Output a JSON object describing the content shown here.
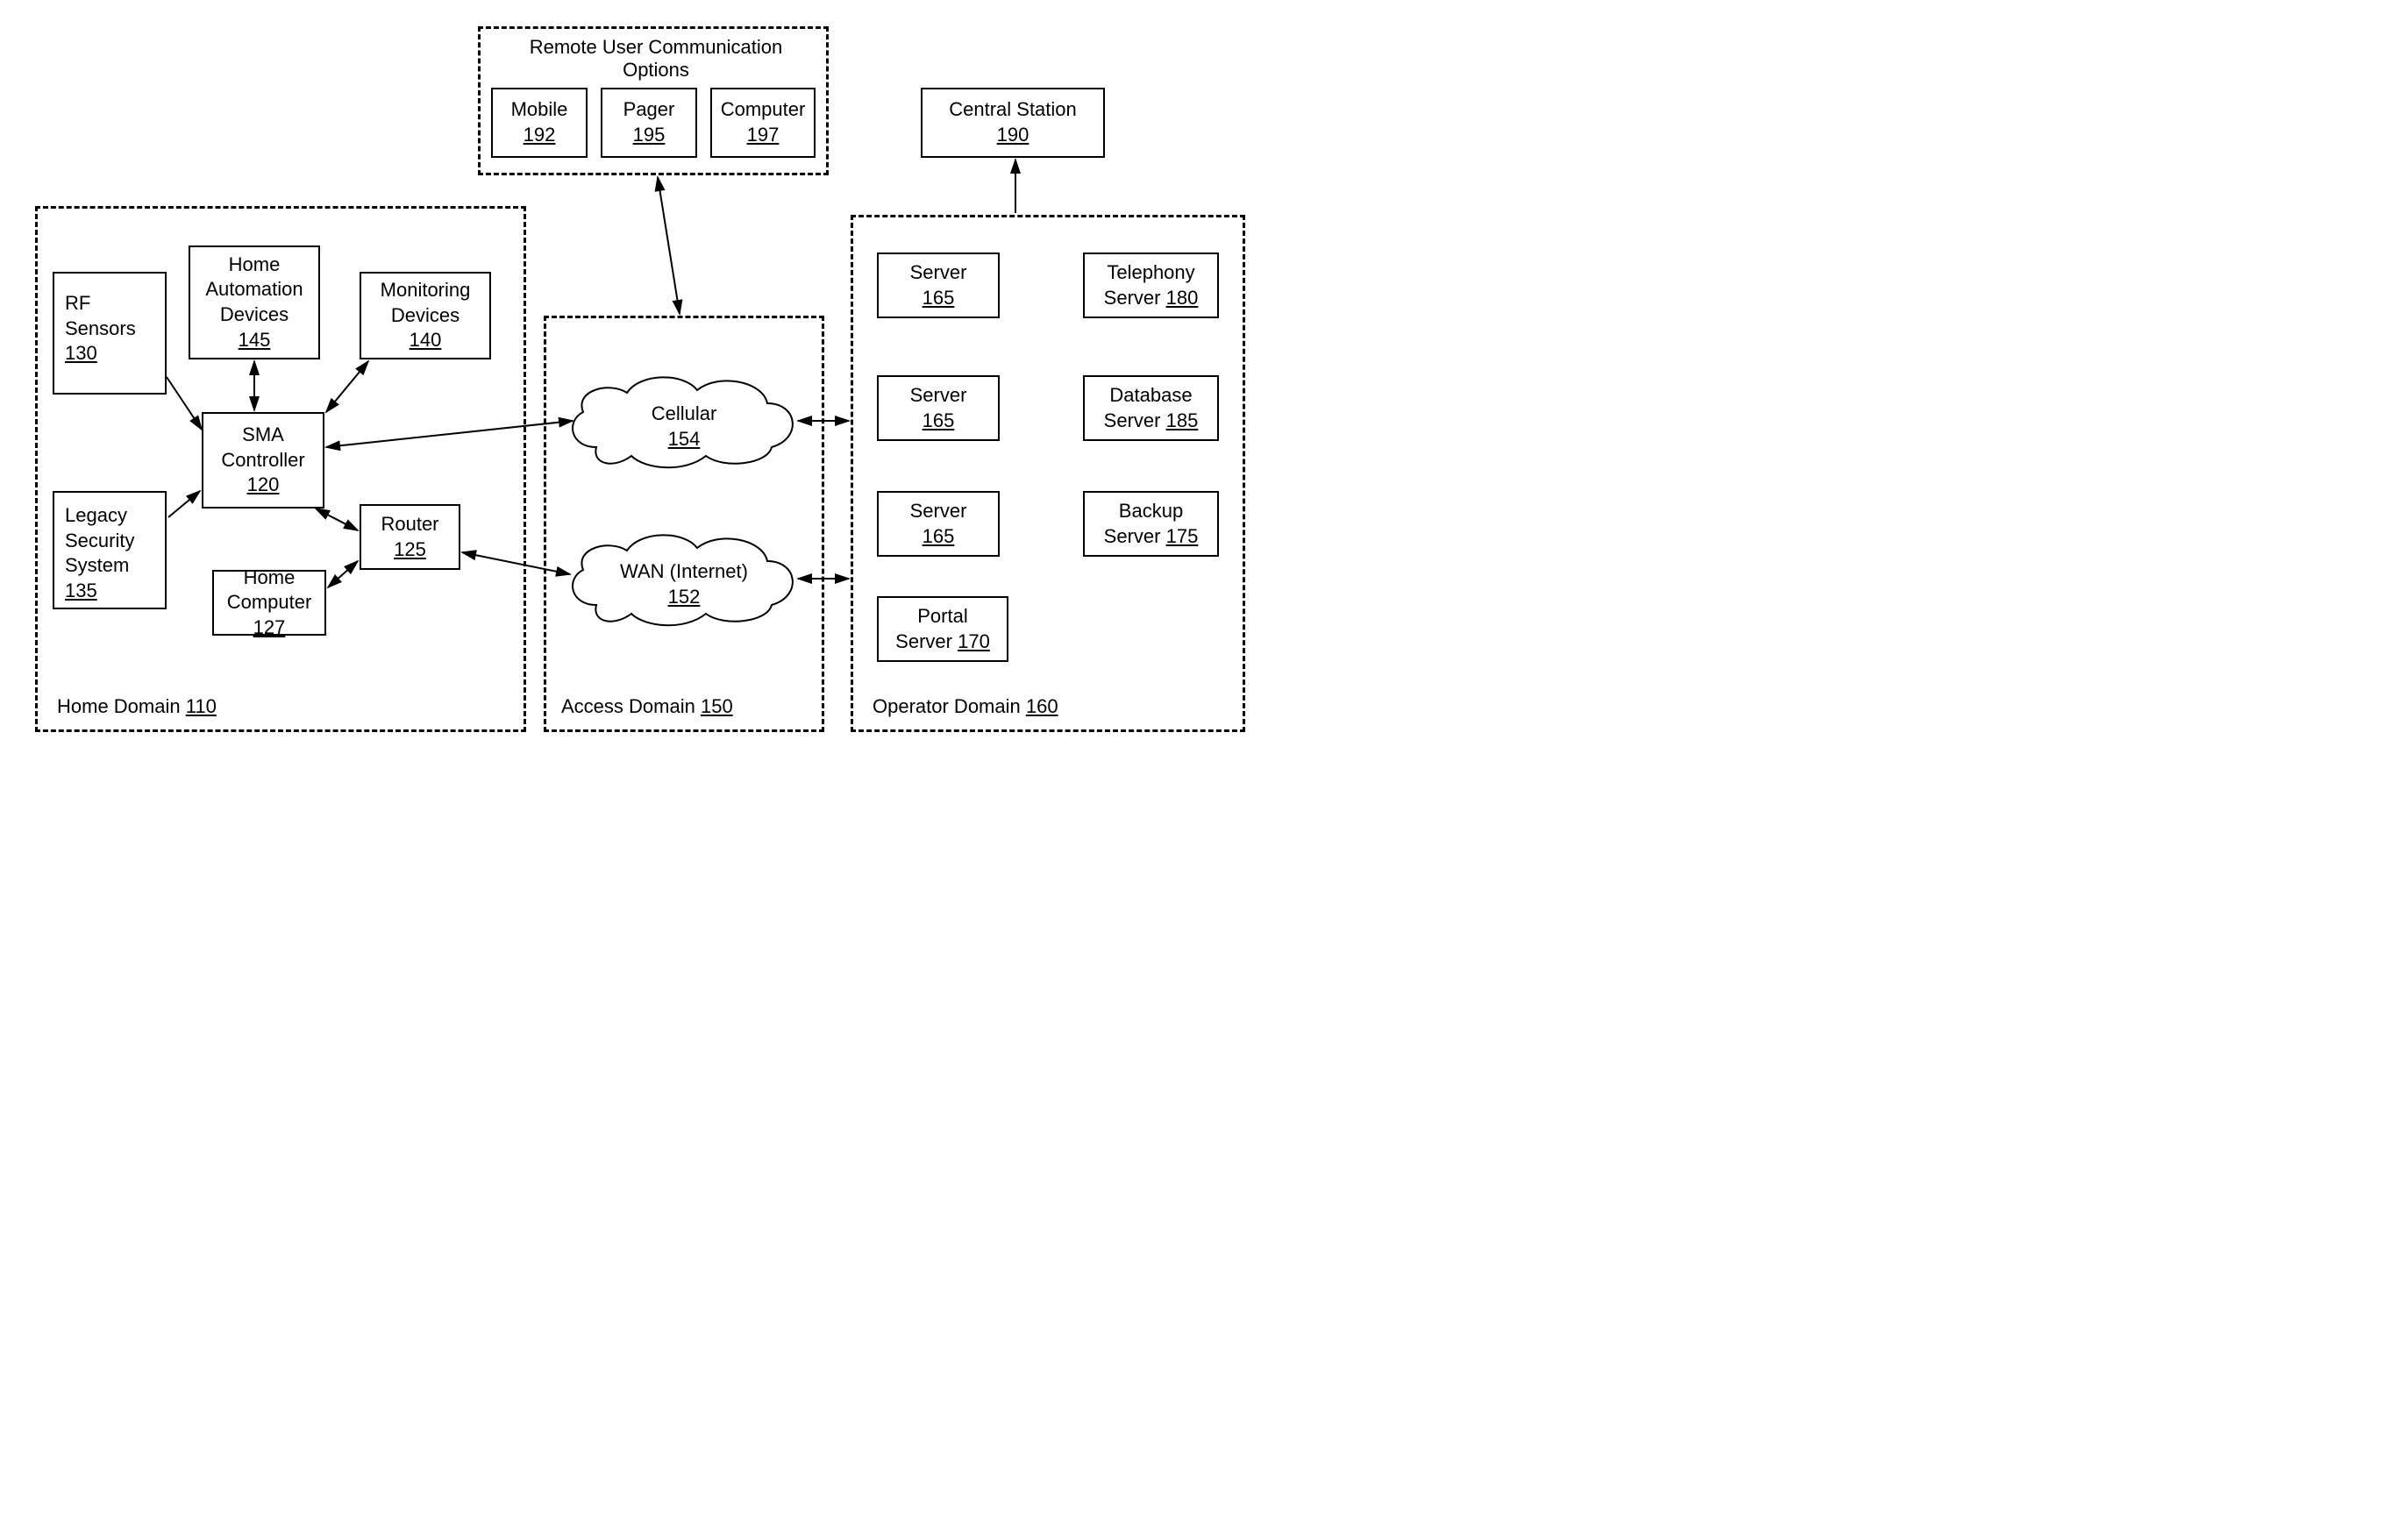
{
  "remote": {
    "title": "Remote User Communication Options",
    "mobile": {
      "label": "Mobile",
      "num": "192"
    },
    "pager": {
      "label": "Pager",
      "num": "195"
    },
    "computer": {
      "label": "Computer",
      "num": "197"
    }
  },
  "central": {
    "label": "Central Station",
    "num": "190"
  },
  "home": {
    "label": "Home Domain",
    "num": "110",
    "rf": {
      "label": "RF Sensors",
      "num": "130"
    },
    "had": {
      "line1": "Home",
      "line2": "Automation",
      "line3": "Devices",
      "num": "145"
    },
    "mon": {
      "line1": "Monitoring",
      "line2": "Devices",
      "num": "140"
    },
    "sma": {
      "line1": "SMA",
      "line2": "Controller",
      "num": "120"
    },
    "legacy": {
      "line1": "Legacy",
      "line2": "Security",
      "line3": "System",
      "num": "135"
    },
    "router": {
      "label": "Router",
      "num": "125"
    },
    "hcomp": {
      "line1": "Home",
      "line2": "Computer",
      "num": "127"
    }
  },
  "access": {
    "label": "Access Domain",
    "num": "150",
    "cell": {
      "label": "Cellular",
      "num": "154"
    },
    "wan": {
      "label": "WAN (Internet)",
      "num": "152"
    }
  },
  "operator": {
    "label": "Operator Domain",
    "num": "160",
    "server1": {
      "label": "Server",
      "num": "165"
    },
    "server2": {
      "label": "Server",
      "num": "165"
    },
    "server3": {
      "label": "Server",
      "num": "165"
    },
    "portal": {
      "line1": "Portal",
      "line2pre": "Server ",
      "num": "170"
    },
    "tel": {
      "line1": "Telephony",
      "line2pre": "Server ",
      "num": "180"
    },
    "db": {
      "line1": "Database",
      "line2pre": "Server ",
      "num": "185"
    },
    "backup": {
      "line1": "Backup",
      "line2pre": "Server ",
      "num": "175"
    }
  }
}
